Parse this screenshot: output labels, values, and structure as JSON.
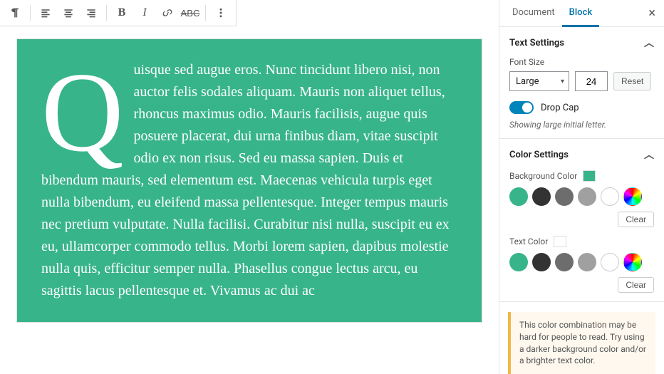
{
  "toolbar": {},
  "content": {
    "dropcap": "Q",
    "text": "uisque sed augue eros. Nunc tincidunt libero nisi, non auctor felis sodales aliquam. Mauris non aliquet tellus, rhoncus maximus odio. Mauris facilisis, augue quis posuere placerat, dui urna finibus diam, vitae suscipit odio ex non risus. Sed eu massa sapien. Duis et bibendum mauris, sed elementum est. Maecenas vehicula turpis eget nulla bibendum, eu eleifend massa pellentesque. Integer tempus mauris nec pretium vulputate. Nulla facilisi. Curabitur nisi nulla, suscipit eu ex eu, ullamcorper commodo tellus. Morbi lorem sapien, dapibus molestie nulla quis, efficitur semper nulla. Phasellus congue lectus arcu, eu sagittis lacus pellentesque et. Vivamus ac dui ac"
  },
  "sidebar": {
    "tabs": {
      "document": "Document",
      "block": "Block"
    },
    "panels": {
      "text_settings": {
        "title": "Text Settings",
        "font_size_label": "Font Size",
        "font_size_preset": "Large",
        "font_size_value": "24",
        "reset": "Reset",
        "dropcap_label": "Drop Cap",
        "dropcap_hint": "Showing large initial letter."
      },
      "color_settings": {
        "title": "Color Settings",
        "bg_label": "Background Color",
        "text_label": "Text Color",
        "clear": "Clear",
        "swatches": {
          "green": "#37b48a",
          "dark": "#333333",
          "gray1": "#6d6d6d",
          "gray2": "#a0a0a0",
          "white": "#ffffff"
        },
        "bg_current": "#37b48a",
        "text_current": "#ffffff"
      }
    },
    "notice": "This color combination may be hard for people to read. Try using a darker background color and/or a brighter text color."
  }
}
